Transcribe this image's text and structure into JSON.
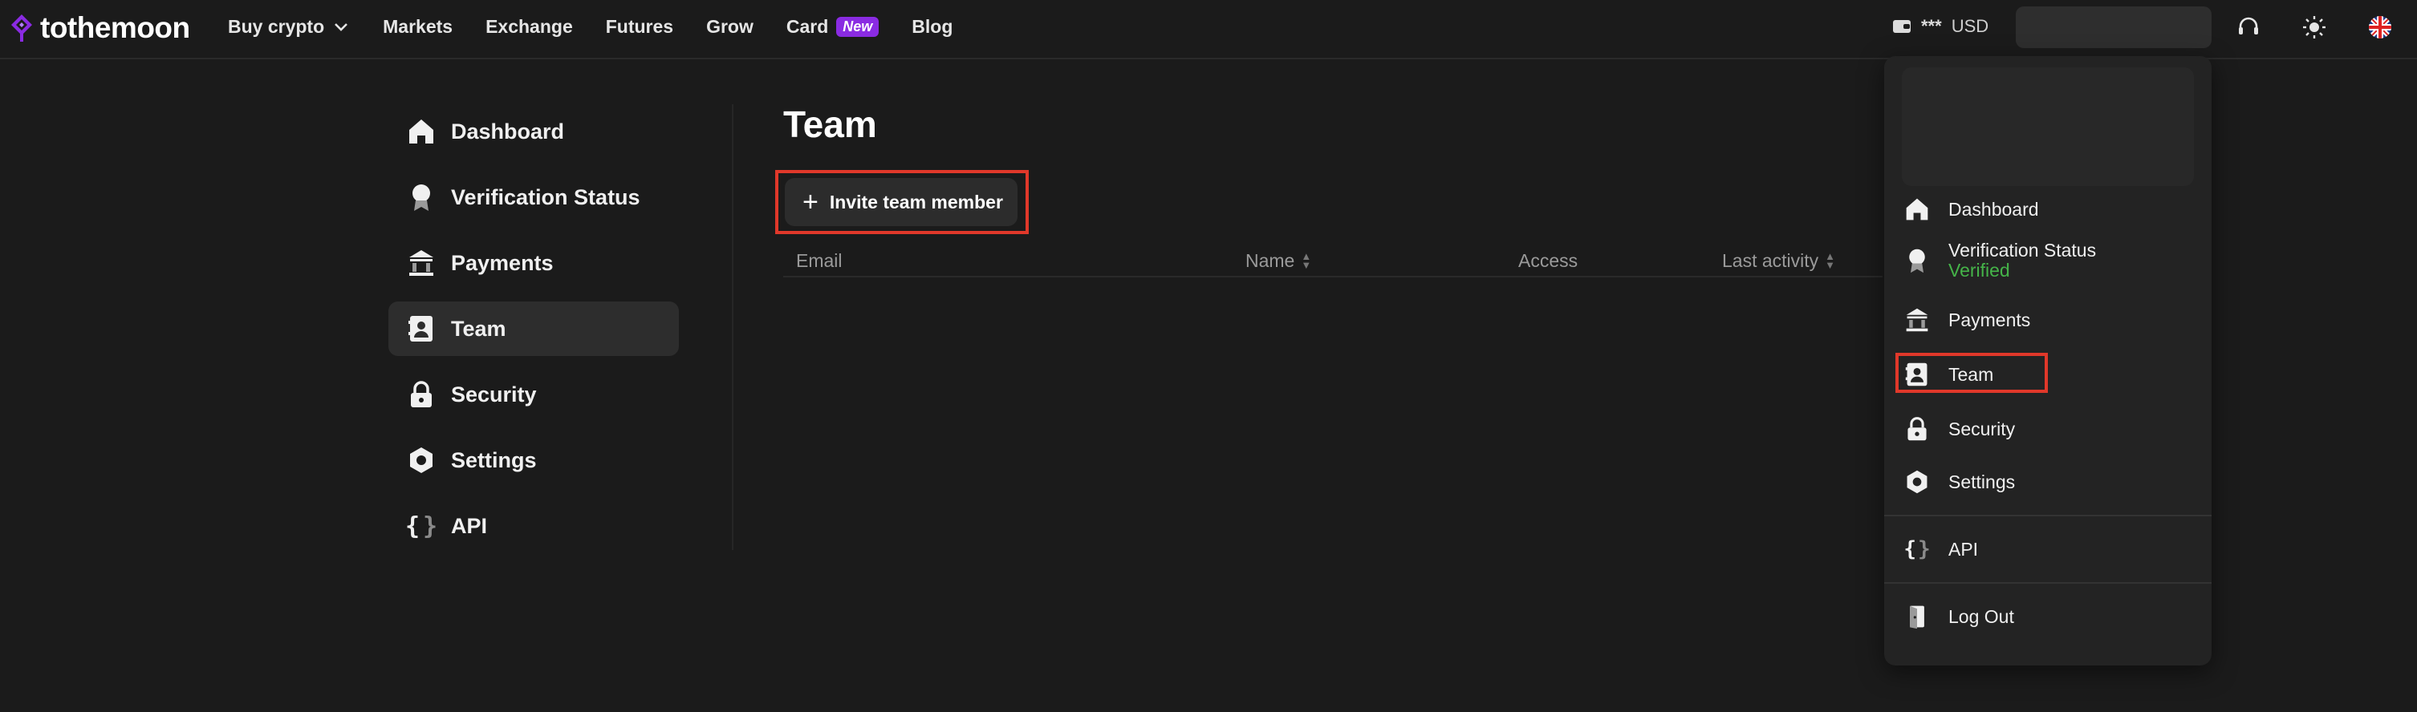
{
  "brand": {
    "name": "tothemoon",
    "accent": "#8a2be2"
  },
  "nav": {
    "items": [
      {
        "label": "Buy crypto",
        "has_dropdown": true
      },
      {
        "label": "Markets"
      },
      {
        "label": "Exchange"
      },
      {
        "label": "Futures"
      },
      {
        "label": "Grow"
      },
      {
        "label": "Card",
        "badge": "New"
      },
      {
        "label": "Blog"
      }
    ]
  },
  "header": {
    "wallet_mask": "***",
    "currency": "USD",
    "icons": [
      "headset-icon",
      "sun-icon",
      "uk-flag-icon"
    ]
  },
  "sidebar": {
    "items": [
      {
        "label": "Dashboard",
        "icon": "home-icon"
      },
      {
        "label": "Verification Status",
        "icon": "badge-icon"
      },
      {
        "label": "Payments",
        "icon": "bank-icon"
      },
      {
        "label": "Team",
        "icon": "team-icon",
        "active": true
      },
      {
        "label": "Security",
        "icon": "lock-icon"
      },
      {
        "label": "Settings",
        "icon": "settings-icon"
      },
      {
        "label": "API",
        "icon": "api-icon"
      }
    ]
  },
  "main": {
    "title": "Team",
    "invite_label": "Invite team member",
    "columns": [
      {
        "label": "Email",
        "sortable": false
      },
      {
        "label": "Name",
        "sortable": true
      },
      {
        "label": "Access",
        "sortable": false
      },
      {
        "label": "Last activity",
        "sortable": true
      }
    ]
  },
  "dropdown": {
    "items": [
      {
        "label": "Dashboard",
        "icon": "home-icon"
      },
      {
        "label": "Verification Status",
        "sub": "Verified",
        "icon": "badge-icon"
      },
      {
        "label": "Payments",
        "icon": "bank-icon"
      },
      {
        "label": "Team",
        "icon": "team-icon"
      },
      {
        "label": "Security",
        "icon": "lock-icon"
      },
      {
        "label": "Settings",
        "icon": "settings-icon"
      },
      {
        "label": "API",
        "icon": "api-icon"
      },
      {
        "label": "Log Out",
        "icon": "logout-icon"
      }
    ],
    "verified_color": "#45b449"
  },
  "highlight_color": "#e0382a"
}
